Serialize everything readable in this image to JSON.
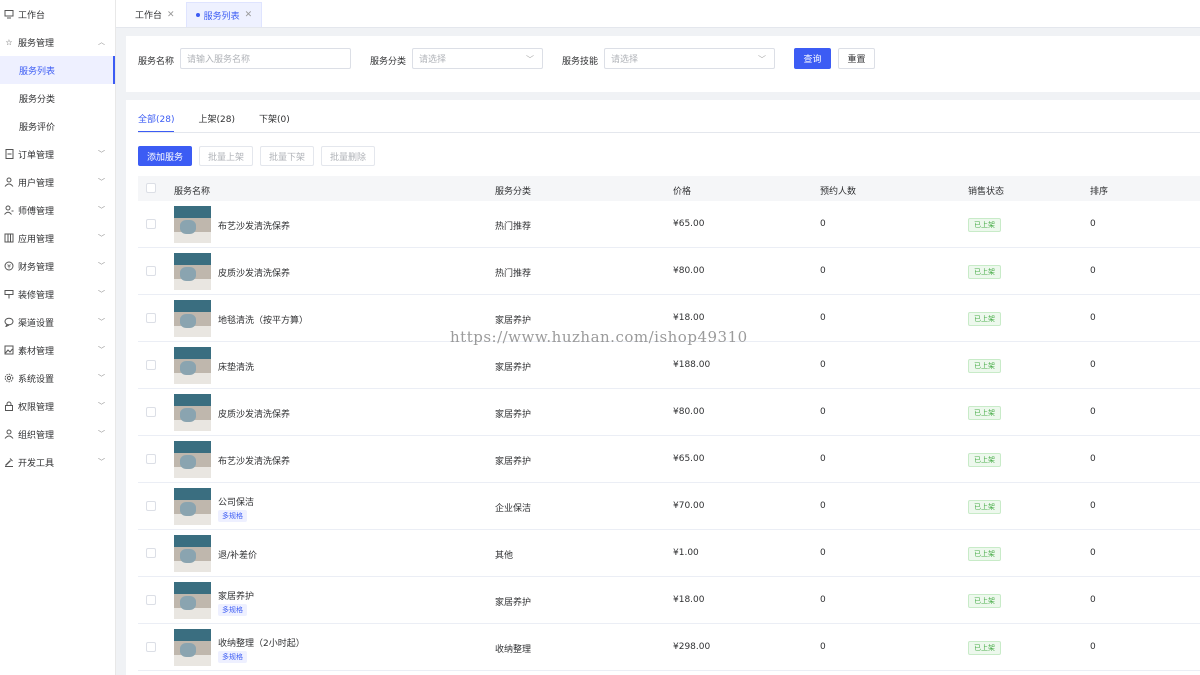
{
  "sidebar": {
    "items": [
      {
        "label": "工作台",
        "icon": "monitor-icon"
      },
      {
        "label": "服务管理",
        "icon": "star-icon",
        "expanded": true,
        "children": [
          {
            "label": "服务列表",
            "active": true
          },
          {
            "label": "服务分类"
          },
          {
            "label": "服务评价"
          }
        ]
      },
      {
        "label": "订单管理",
        "icon": "order-icon"
      },
      {
        "label": "用户管理",
        "icon": "user-icon"
      },
      {
        "label": "师傅管理",
        "icon": "worker-icon"
      },
      {
        "label": "应用管理",
        "icon": "app-icon"
      },
      {
        "label": "财务管理",
        "icon": "finance-icon"
      },
      {
        "label": "装修管理",
        "icon": "decorate-icon"
      },
      {
        "label": "渠道设置",
        "icon": "channel-icon"
      },
      {
        "label": "素材管理",
        "icon": "image-icon"
      },
      {
        "label": "系统设置",
        "icon": "gear-icon"
      },
      {
        "label": "权限管理",
        "icon": "lock-icon"
      },
      {
        "label": "组织管理",
        "icon": "org-icon"
      },
      {
        "label": "开发工具",
        "icon": "tool-icon"
      }
    ]
  },
  "tabs": [
    {
      "label": "工作台",
      "active": false
    },
    {
      "label": "服务列表",
      "active": true
    }
  ],
  "filter": {
    "name_label": "服务名称",
    "name_placeholder": "请输入服务名称",
    "category_label": "服务分类",
    "category_placeholder": "请选择",
    "skill_label": "服务技能",
    "skill_placeholder": "请选择",
    "query_label": "查询",
    "reset_label": "重置"
  },
  "status_tabs": [
    {
      "label": "全部(28)",
      "active": true
    },
    {
      "label": "上架(28)",
      "active": false
    },
    {
      "label": "下架(0)",
      "active": false
    }
  ],
  "actions": {
    "add": "添加服务",
    "batch_up": "批量上架",
    "batch_down": "批量下架",
    "batch_delete": "批量删除"
  },
  "table": {
    "columns": [
      "服务名称",
      "服务分类",
      "价格",
      "预约人数",
      "销售状态",
      "排序"
    ],
    "rows": [
      {
        "name": "布艺沙发清洗保养",
        "category": "热门推荐",
        "price": "¥65.00",
        "bookings": "0",
        "status": "已上架",
        "sort": "0",
        "tag": ""
      },
      {
        "name": "皮质沙发清洗保养",
        "category": "热门推荐",
        "price": "¥80.00",
        "bookings": "0",
        "status": "已上架",
        "sort": "0",
        "tag": ""
      },
      {
        "name": "地毯清洗（按平方算）",
        "category": "家居养护",
        "price": "¥18.00",
        "bookings": "0",
        "status": "已上架",
        "sort": "0",
        "tag": ""
      },
      {
        "name": "床垫清洗",
        "category": "家居养护",
        "price": "¥188.00",
        "bookings": "0",
        "status": "已上架",
        "sort": "0",
        "tag": ""
      },
      {
        "name": "皮质沙发清洗保养",
        "category": "家居养护",
        "price": "¥80.00",
        "bookings": "0",
        "status": "已上架",
        "sort": "0",
        "tag": ""
      },
      {
        "name": "布艺沙发清洗保养",
        "category": "家居养护",
        "price": "¥65.00",
        "bookings": "0",
        "status": "已上架",
        "sort": "0",
        "tag": ""
      },
      {
        "name": "公司保洁",
        "category": "企业保洁",
        "price": "¥70.00",
        "bookings": "0",
        "status": "已上架",
        "sort": "0",
        "tag": "多规格"
      },
      {
        "name": "退/补差价",
        "category": "其他",
        "price": "¥1.00",
        "bookings": "0",
        "status": "已上架",
        "sort": "0",
        "tag": ""
      },
      {
        "name": "家居养护",
        "category": "家居养护",
        "price": "¥18.00",
        "bookings": "0",
        "status": "已上架",
        "sort": "0",
        "tag": "多规格"
      },
      {
        "name": "收纳整理（2小时起）",
        "category": "收纳整理",
        "price": "¥298.00",
        "bookings": "0",
        "status": "已上架",
        "sort": "0",
        "tag": "多规格"
      }
    ]
  },
  "watermark": "https://www.huzhan.com/ishop49310",
  "colors": {
    "primary": "#3c5cf4",
    "success": "#4cae4c"
  }
}
